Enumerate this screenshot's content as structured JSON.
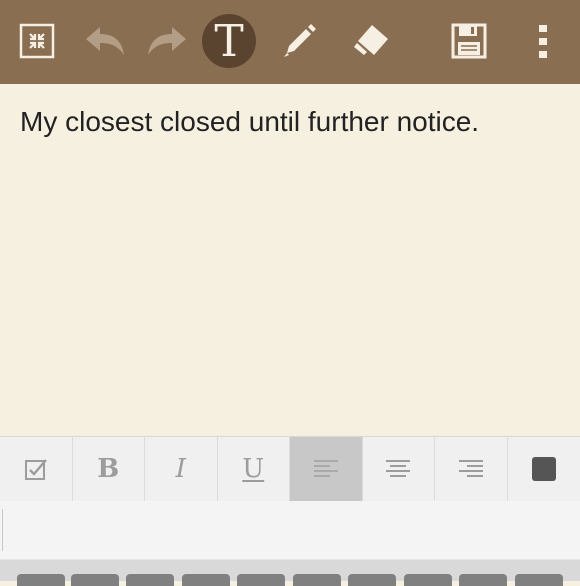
{
  "toolbar": {
    "buttons": [
      {
        "id": "minimize",
        "icon": "minimize-icon"
      },
      {
        "id": "undo",
        "icon": "undo-icon"
      },
      {
        "id": "redo",
        "icon": "redo-icon"
      },
      {
        "id": "text",
        "icon": "text-tool-icon",
        "glyph": "T",
        "active": true
      },
      {
        "id": "pen",
        "icon": "pen-icon"
      },
      {
        "id": "eraser",
        "icon": "eraser-icon"
      },
      {
        "id": "save",
        "icon": "save-icon"
      },
      {
        "id": "more",
        "icon": "more-vertical-icon"
      }
    ]
  },
  "note": {
    "text": "My closest closed until further notice."
  },
  "format_bar": {
    "buttons": [
      {
        "id": "checkbox",
        "icon": "checkbox-icon"
      },
      {
        "id": "bold",
        "label": "B",
        "icon": "bold-icon"
      },
      {
        "id": "italic",
        "label": "I",
        "icon": "italic-icon"
      },
      {
        "id": "underline",
        "label": "U",
        "icon": "underline-icon"
      },
      {
        "id": "align-left",
        "icon": "align-left-icon",
        "selected": true
      },
      {
        "id": "align-center",
        "icon": "align-center-icon"
      },
      {
        "id": "align-right",
        "icon": "align-right-icon"
      },
      {
        "id": "text-color",
        "icon": "color-swatch-icon"
      }
    ]
  },
  "colors": {
    "toolbar_bg": "#8a6e52",
    "active_tool_bg": "#5a4430",
    "note_bg": "#f5f0e0",
    "text_color_swatch": "#555555"
  }
}
